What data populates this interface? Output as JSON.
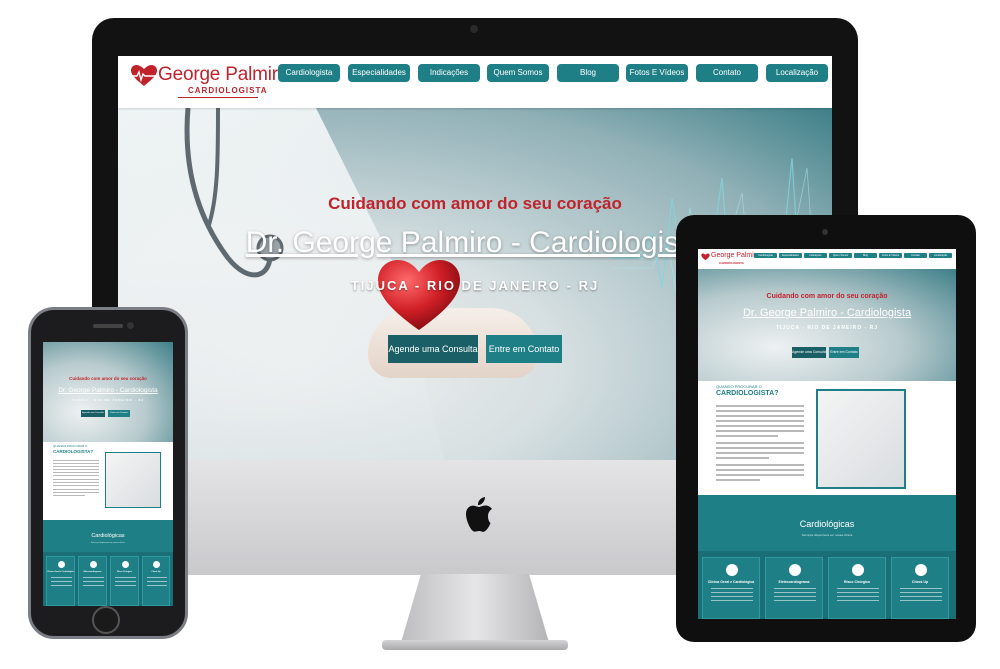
{
  "site": {
    "logo_name": "George Palmiro",
    "logo_sub": "CARDIOLOGISTA",
    "nav": [
      "Cardiologista",
      "Especialidades",
      "Indicações",
      "Quem Somos",
      "Blog",
      "Fotos E Vídeos",
      "Contato",
      "Localização"
    ],
    "hero": {
      "kicker": "Cuidando com amor do seu coração",
      "title": "Dr. George Palmiro - Cardiologista",
      "location": "TIJUCA - RIO DE JANEIRO - RJ",
      "cta_primary": "Agende uma Consulta",
      "cta_secondary": "Entre em Contato"
    },
    "about": {
      "kicker": "QUANDO PROCURAR O",
      "title": "CARDIOLOGISTA?"
    },
    "services": {
      "title": "Cardiológicas",
      "subtitle": "Serviços disponíveis em nossa clínica",
      "cards": [
        "Clínica Geral e Cardiológica",
        "Eletrocardiograma",
        "Risco Cirúrgico",
        "Check Up"
      ]
    }
  },
  "colors": {
    "brand_red": "#c0232b",
    "teal": "#1f7f86",
    "teal_dark": "#1b5f66"
  },
  "devices": {
    "desktop_logo_icon": "apple-logo-icon"
  }
}
